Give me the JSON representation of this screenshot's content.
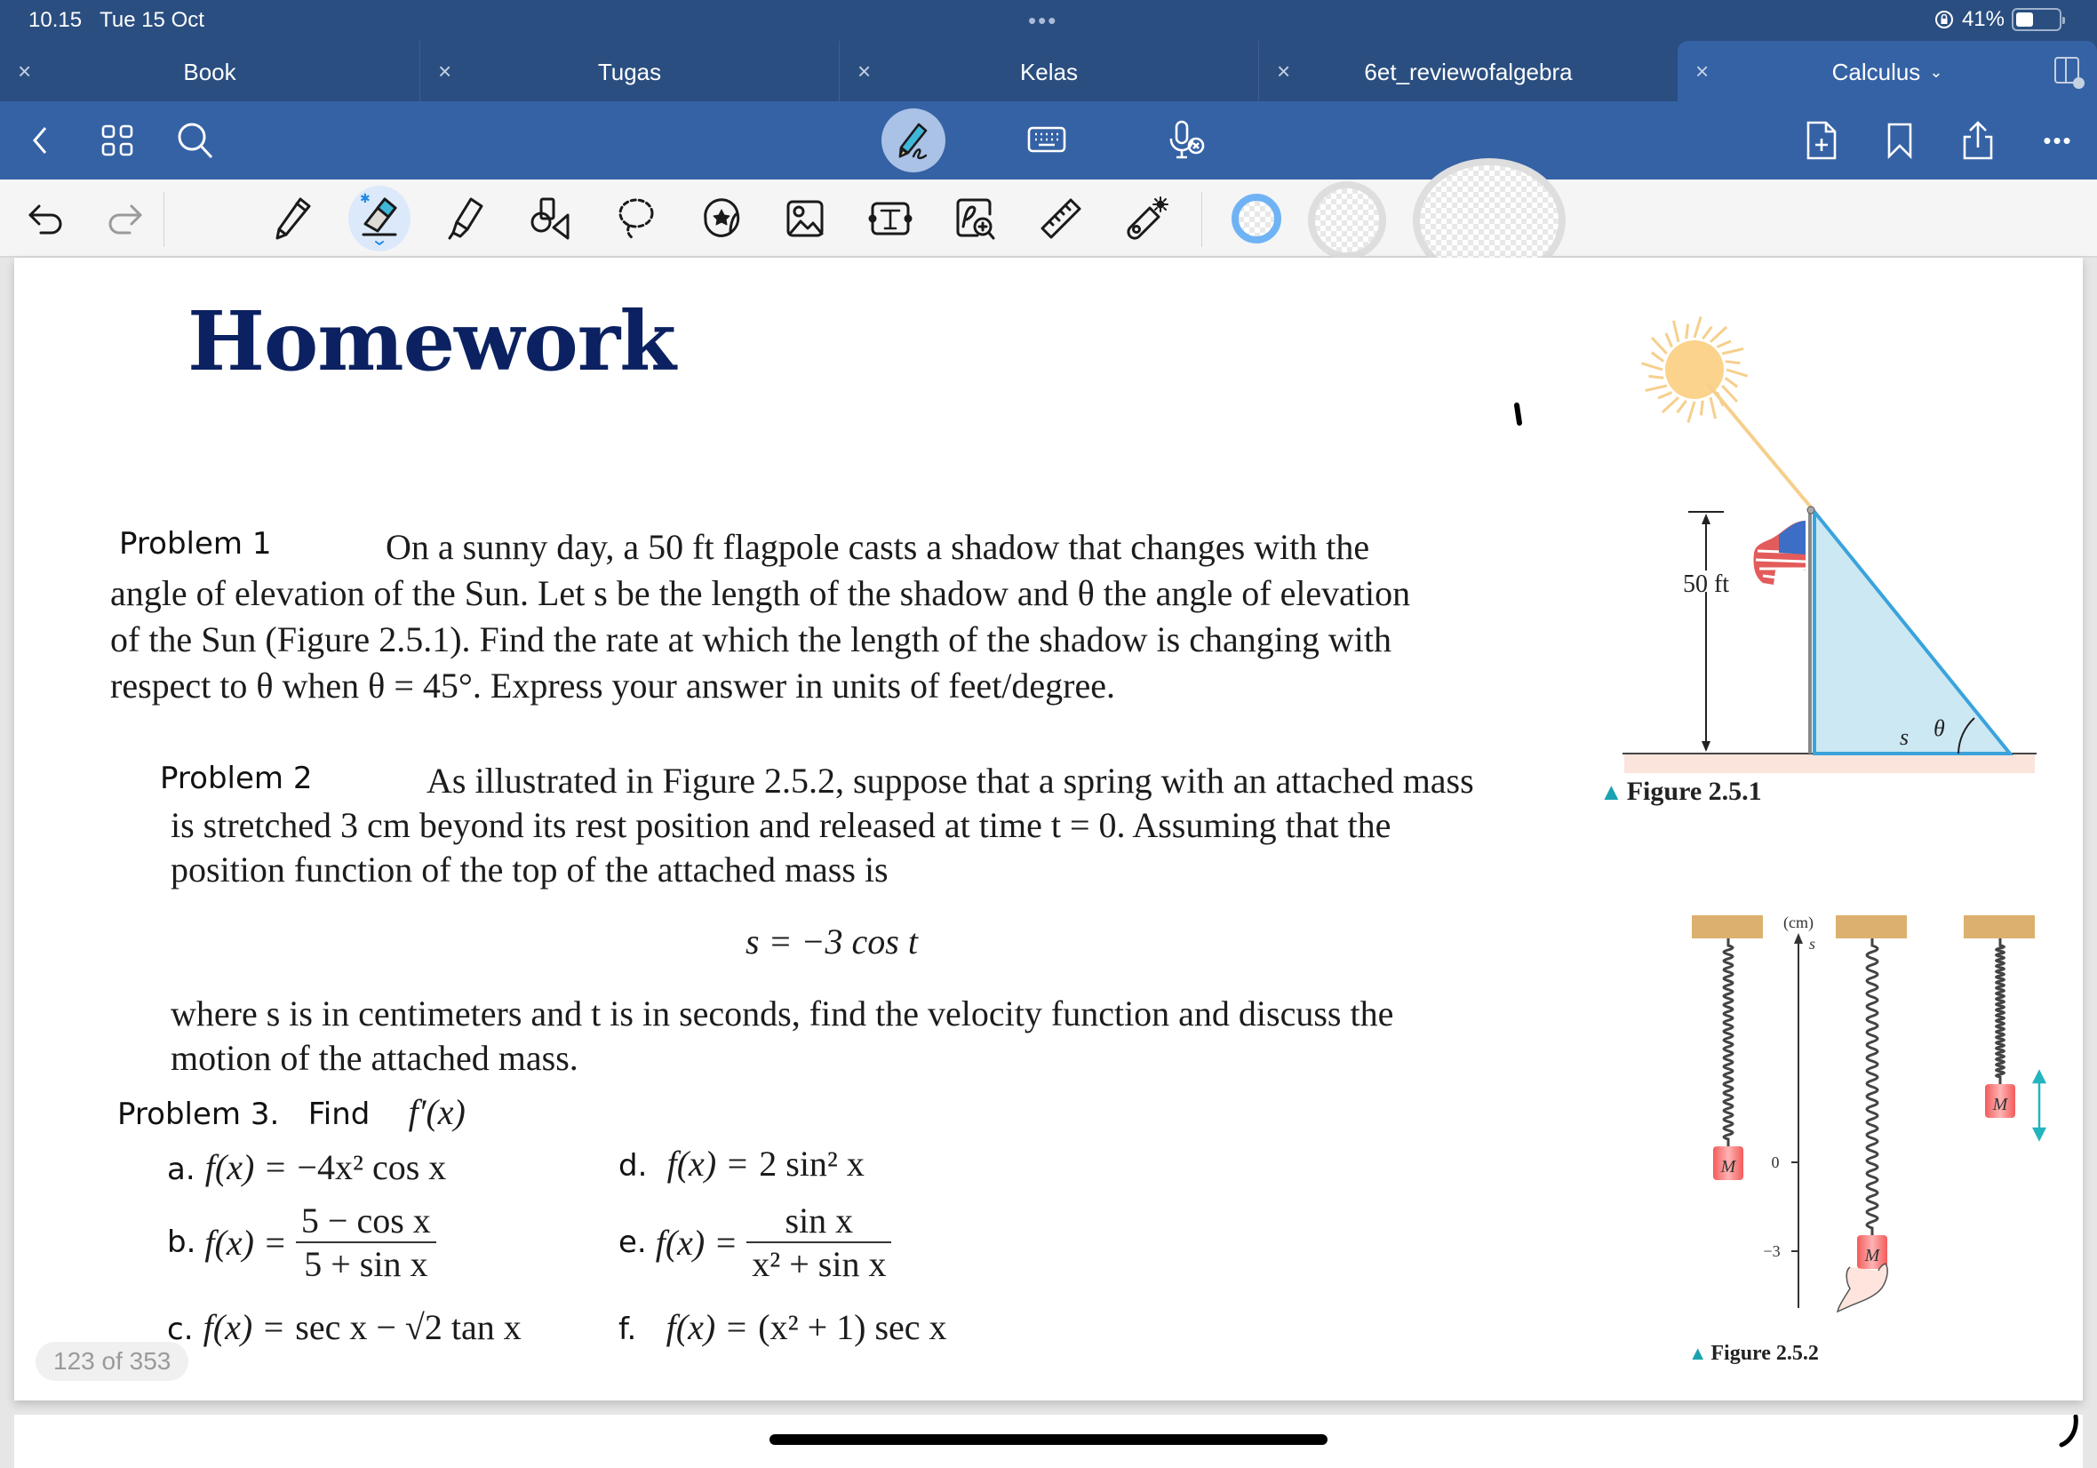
{
  "status_bar": {
    "time": "10.15",
    "date": "Tue 15 Oct",
    "multitask_dots": "•••",
    "battery_percent": "41%",
    "battery_level": 0.41,
    "orientation_lock_icon": "orientation-lock-icon"
  },
  "tabs": [
    {
      "label": "Book",
      "active": false
    },
    {
      "label": "Tugas",
      "active": false
    },
    {
      "label": "Kelas",
      "active": false
    },
    {
      "label": "6et_reviewofalgebra",
      "active": false
    },
    {
      "label": "Calculus",
      "active": true,
      "has_dropdown": true
    }
  ],
  "tab_close_glyph": "×",
  "tab_dropdown_glyph": "⌄",
  "nav_toolbar": {
    "left": [
      "back-icon",
      "grid-view-icon",
      "search-icon"
    ],
    "center": [
      "handwriting-pen-mode-icon",
      "keyboard-icon",
      "voice-input-off-icon"
    ],
    "right": [
      "add-page-icon",
      "bookmark-icon",
      "share-icon",
      "more-icon"
    ],
    "more_glyph": "•••"
  },
  "annotation_toolbar": {
    "undo": "undo-icon",
    "redo": "redo-icon",
    "tools": [
      "pen",
      "eraser",
      "highlighter",
      "shapes",
      "lasso",
      "sticker",
      "image",
      "text-box",
      "zoom-box",
      "ruler",
      "laser-pointer"
    ],
    "selected_tool": "eraser",
    "text_box_glyph": "T",
    "colors": [
      "#6fb3f5",
      "transparent",
      "transparent"
    ]
  },
  "document": {
    "title": "Homework",
    "problem1": {
      "label": "Problem 1",
      "lines": [
        "On a sunny day, a 50 ft flagpole casts a shadow that changes with the",
        "angle of elevation of the Sun. Let s be the length of the shadow and θ the angle of elevation",
        "of the Sun (Figure 2.5.1). Find the rate at which the length of the shadow is changing with",
        "respect to θ when θ = 45°. Express your answer in units of feet/degree."
      ]
    },
    "problem2": {
      "label": "Problem 2",
      "lines": [
        "As illustrated in Figure 2.5.2, suppose that a spring with an attached mass",
        "is stretched 3 cm beyond its rest position and released at time t = 0. Assuming that the",
        "position function of the top of the attached mass is"
      ],
      "equation": "s = −3 cos t",
      "after_lines": [
        "where s is in centimeters and t is in seconds, find the velocity function and discuss the",
        "motion of the attached mass."
      ]
    },
    "problem3": {
      "label": "Problem 3.",
      "find": "Find",
      "target": "f′(x)",
      "items": [
        {
          "letter": "a.",
          "lhs": "f(x) =",
          "rhs": "−4x² cos x"
        },
        {
          "letter": "b.",
          "lhs": "f(x) =",
          "num": "5 − cos x",
          "den": "5 + sin x"
        },
        {
          "letter": "c.",
          "lhs": "f(x) =",
          "rhs": "sec x − √2 tan x"
        },
        {
          "letter": "d.",
          "lhs": "f(x) =",
          "rhs": "2 sin² x"
        },
        {
          "letter": "e.",
          "lhs": "f(x) =",
          "num": "sin x",
          "den": "x² + sin x"
        },
        {
          "letter": "f.",
          "lhs": "f(x) =",
          "rhs": "(x² + 1) sec x"
        }
      ]
    },
    "figure1": {
      "caption": "Figure 2.5.1",
      "height_label": "50 ft",
      "shadow_label": "s",
      "angle_label": "θ"
    },
    "figure2": {
      "caption": "Figure 2.5.2",
      "axis_unit": "(cm)",
      "axis_var": "s",
      "ticks": [
        "0",
        "−3"
      ],
      "mass_label": "M"
    },
    "page_counter": "123 of 353",
    "caption_marker": "▲"
  }
}
